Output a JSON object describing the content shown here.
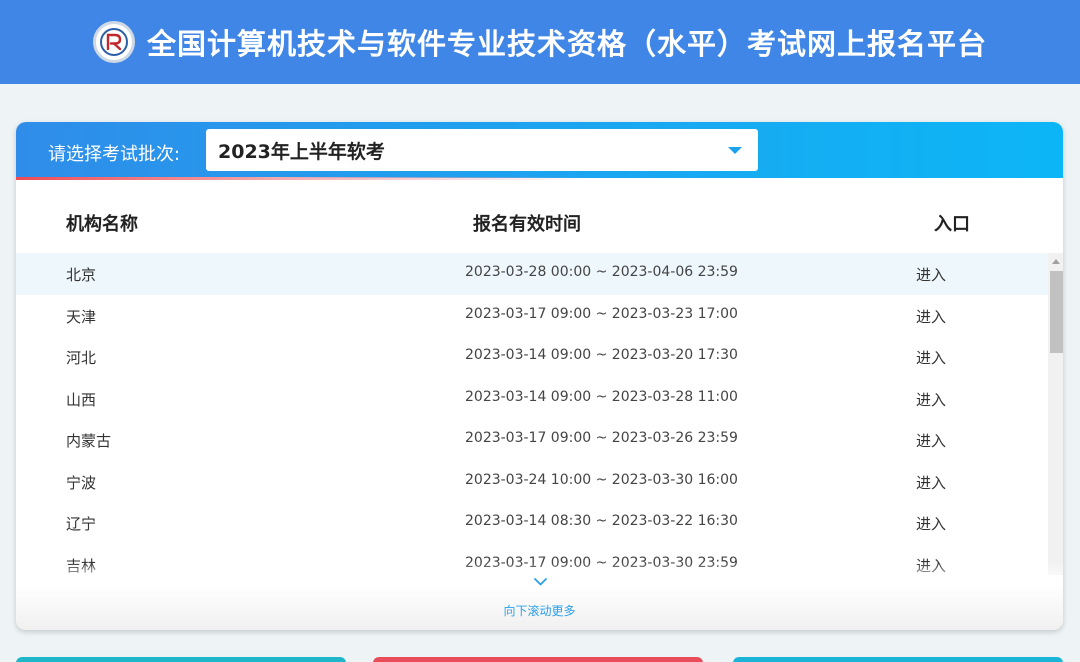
{
  "header": {
    "title": "全国计算机技术与软件专业技术资格（水平）考试网上报名平台"
  },
  "batch": {
    "label": "请选择考试批次:",
    "selected": "2023年上半年软考"
  },
  "table": {
    "columns": [
      "机构名称",
      "报名有效时间",
      "入口"
    ],
    "rows": [
      {
        "name": "北京",
        "time": "2023-03-28 00:00 ~ 2023-04-06 23:59",
        "entry": "进入"
      },
      {
        "name": "天津",
        "time": "2023-03-17 09:00 ~ 2023-03-23 17:00",
        "entry": "进入"
      },
      {
        "name": "河北",
        "time": "2023-03-14 09:00 ~ 2023-03-20 17:30",
        "entry": "进入"
      },
      {
        "name": "山西",
        "time": "2023-03-14 09:00 ~ 2023-03-28 11:00",
        "entry": "进入"
      },
      {
        "name": "内蒙古",
        "time": "2023-03-17 09:00 ~ 2023-03-26 23:59",
        "entry": "进入"
      },
      {
        "name": "宁波",
        "time": "2023-03-24 10:00 ~ 2023-03-30 16:00",
        "entry": "进入"
      },
      {
        "name": "辽宁",
        "time": "2023-03-14 08:30 ~ 2023-03-22 16:30",
        "entry": "进入"
      },
      {
        "name": "吉林",
        "time": "2023-03-17 09:00 ~ 2023-03-30 23:59",
        "entry": "进入"
      }
    ]
  },
  "scroll_more": "向下滚动更多",
  "colors": {
    "header_bg": "#3f86e6",
    "accent": "#1aa3ec",
    "accent_red": "#ef4a55"
  }
}
